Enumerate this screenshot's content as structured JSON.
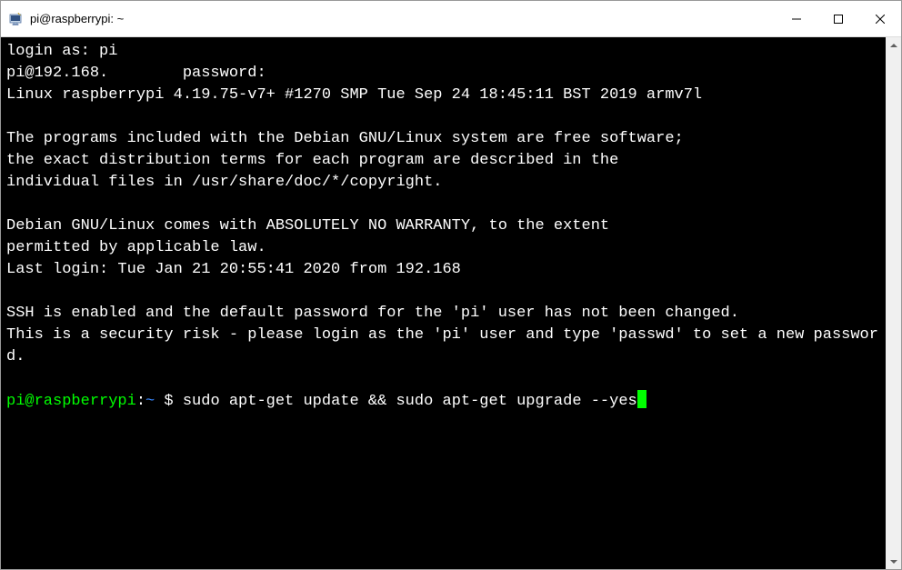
{
  "window": {
    "title": "pi@raspberrypi: ~"
  },
  "terminal": {
    "lines": {
      "l0": "login as: pi",
      "l1": "pi@192.168.        password:",
      "l2": "Linux raspberrypi 4.19.75-v7+ #1270 SMP Tue Sep 24 18:45:11 BST 2019 armv7l",
      "l3": "",
      "l4": "The programs included with the Debian GNU/Linux system are free software;",
      "l5": "the exact distribution terms for each program are described in the",
      "l6": "individual files in /usr/share/doc/*/copyright.",
      "l7": "",
      "l8": "Debian GNU/Linux comes with ABSOLUTELY NO WARRANTY, to the extent",
      "l9": "permitted by applicable law.",
      "l10": "Last login: Tue Jan 21 20:55:41 2020 from 192.168",
      "l11": "",
      "l12": "SSH is enabled and the default password for the 'pi' user has not been changed.",
      "l13": "This is a security risk - please login as the 'pi' user and type 'passwd' to set a new password.",
      "l14": ""
    },
    "prompt": {
      "user": "pi@raspberrypi",
      "colon": ":",
      "path": "~",
      "dollar": " $ ",
      "command": "sudo apt-get update && sudo apt-get upgrade --yes"
    }
  }
}
